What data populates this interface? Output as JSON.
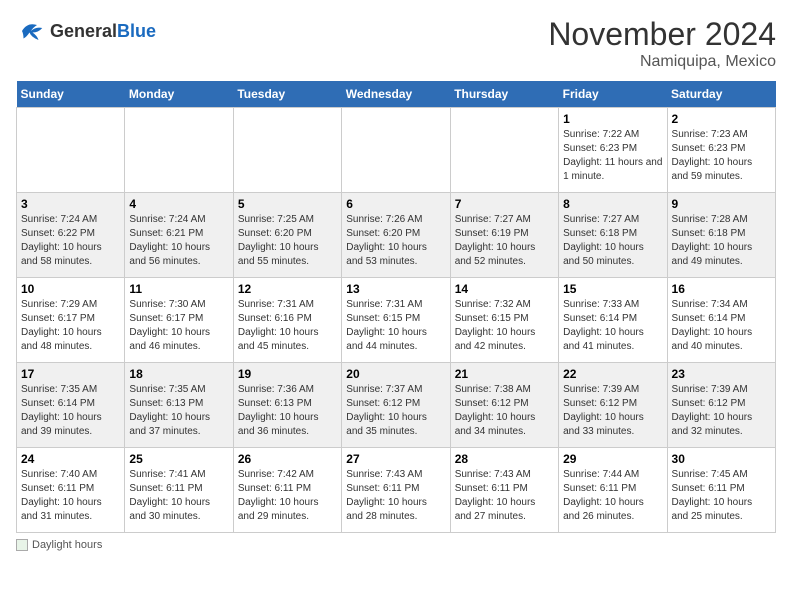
{
  "header": {
    "logo_general": "General",
    "logo_blue": "Blue",
    "month": "November 2024",
    "location": "Namiquipa, Mexico"
  },
  "weekdays": [
    "Sunday",
    "Monday",
    "Tuesday",
    "Wednesday",
    "Thursday",
    "Friday",
    "Saturday"
  ],
  "weeks": [
    [
      {
        "day": "",
        "sunrise": "",
        "sunset": "",
        "daylight": ""
      },
      {
        "day": "",
        "sunrise": "",
        "sunset": "",
        "daylight": ""
      },
      {
        "day": "",
        "sunrise": "",
        "sunset": "",
        "daylight": ""
      },
      {
        "day": "",
        "sunrise": "",
        "sunset": "",
        "daylight": ""
      },
      {
        "day": "",
        "sunrise": "",
        "sunset": "",
        "daylight": ""
      },
      {
        "day": "1",
        "sunrise": "Sunrise: 7:22 AM",
        "sunset": "Sunset: 6:23 PM",
        "daylight": "Daylight: 11 hours and 1 minute."
      },
      {
        "day": "2",
        "sunrise": "Sunrise: 7:23 AM",
        "sunset": "Sunset: 6:23 PM",
        "daylight": "Daylight: 10 hours and 59 minutes."
      }
    ],
    [
      {
        "day": "3",
        "sunrise": "Sunrise: 7:24 AM",
        "sunset": "Sunset: 6:22 PM",
        "daylight": "Daylight: 10 hours and 58 minutes."
      },
      {
        "day": "4",
        "sunrise": "Sunrise: 7:24 AM",
        "sunset": "Sunset: 6:21 PM",
        "daylight": "Daylight: 10 hours and 56 minutes."
      },
      {
        "day": "5",
        "sunrise": "Sunrise: 7:25 AM",
        "sunset": "Sunset: 6:20 PM",
        "daylight": "Daylight: 10 hours and 55 minutes."
      },
      {
        "day": "6",
        "sunrise": "Sunrise: 7:26 AM",
        "sunset": "Sunset: 6:20 PM",
        "daylight": "Daylight: 10 hours and 53 minutes."
      },
      {
        "day": "7",
        "sunrise": "Sunrise: 7:27 AM",
        "sunset": "Sunset: 6:19 PM",
        "daylight": "Daylight: 10 hours and 52 minutes."
      },
      {
        "day": "8",
        "sunrise": "Sunrise: 7:27 AM",
        "sunset": "Sunset: 6:18 PM",
        "daylight": "Daylight: 10 hours and 50 minutes."
      },
      {
        "day": "9",
        "sunrise": "Sunrise: 7:28 AM",
        "sunset": "Sunset: 6:18 PM",
        "daylight": "Daylight: 10 hours and 49 minutes."
      }
    ],
    [
      {
        "day": "10",
        "sunrise": "Sunrise: 7:29 AM",
        "sunset": "Sunset: 6:17 PM",
        "daylight": "Daylight: 10 hours and 48 minutes."
      },
      {
        "day": "11",
        "sunrise": "Sunrise: 7:30 AM",
        "sunset": "Sunset: 6:17 PM",
        "daylight": "Daylight: 10 hours and 46 minutes."
      },
      {
        "day": "12",
        "sunrise": "Sunrise: 7:31 AM",
        "sunset": "Sunset: 6:16 PM",
        "daylight": "Daylight: 10 hours and 45 minutes."
      },
      {
        "day": "13",
        "sunrise": "Sunrise: 7:31 AM",
        "sunset": "Sunset: 6:15 PM",
        "daylight": "Daylight: 10 hours and 44 minutes."
      },
      {
        "day": "14",
        "sunrise": "Sunrise: 7:32 AM",
        "sunset": "Sunset: 6:15 PM",
        "daylight": "Daylight: 10 hours and 42 minutes."
      },
      {
        "day": "15",
        "sunrise": "Sunrise: 7:33 AM",
        "sunset": "Sunset: 6:14 PM",
        "daylight": "Daylight: 10 hours and 41 minutes."
      },
      {
        "day": "16",
        "sunrise": "Sunrise: 7:34 AM",
        "sunset": "Sunset: 6:14 PM",
        "daylight": "Daylight: 10 hours and 40 minutes."
      }
    ],
    [
      {
        "day": "17",
        "sunrise": "Sunrise: 7:35 AM",
        "sunset": "Sunset: 6:14 PM",
        "daylight": "Daylight: 10 hours and 39 minutes."
      },
      {
        "day": "18",
        "sunrise": "Sunrise: 7:35 AM",
        "sunset": "Sunset: 6:13 PM",
        "daylight": "Daylight: 10 hours and 37 minutes."
      },
      {
        "day": "19",
        "sunrise": "Sunrise: 7:36 AM",
        "sunset": "Sunset: 6:13 PM",
        "daylight": "Daylight: 10 hours and 36 minutes."
      },
      {
        "day": "20",
        "sunrise": "Sunrise: 7:37 AM",
        "sunset": "Sunset: 6:12 PM",
        "daylight": "Daylight: 10 hours and 35 minutes."
      },
      {
        "day": "21",
        "sunrise": "Sunrise: 7:38 AM",
        "sunset": "Sunset: 6:12 PM",
        "daylight": "Daylight: 10 hours and 34 minutes."
      },
      {
        "day": "22",
        "sunrise": "Sunrise: 7:39 AM",
        "sunset": "Sunset: 6:12 PM",
        "daylight": "Daylight: 10 hours and 33 minutes."
      },
      {
        "day": "23",
        "sunrise": "Sunrise: 7:39 AM",
        "sunset": "Sunset: 6:12 PM",
        "daylight": "Daylight: 10 hours and 32 minutes."
      }
    ],
    [
      {
        "day": "24",
        "sunrise": "Sunrise: 7:40 AM",
        "sunset": "Sunset: 6:11 PM",
        "daylight": "Daylight: 10 hours and 31 minutes."
      },
      {
        "day": "25",
        "sunrise": "Sunrise: 7:41 AM",
        "sunset": "Sunset: 6:11 PM",
        "daylight": "Daylight: 10 hours and 30 minutes."
      },
      {
        "day": "26",
        "sunrise": "Sunrise: 7:42 AM",
        "sunset": "Sunset: 6:11 PM",
        "daylight": "Daylight: 10 hours and 29 minutes."
      },
      {
        "day": "27",
        "sunrise": "Sunrise: 7:43 AM",
        "sunset": "Sunset: 6:11 PM",
        "daylight": "Daylight: 10 hours and 28 minutes."
      },
      {
        "day": "28",
        "sunrise": "Sunrise: 7:43 AM",
        "sunset": "Sunset: 6:11 PM",
        "daylight": "Daylight: 10 hours and 27 minutes."
      },
      {
        "day": "29",
        "sunrise": "Sunrise: 7:44 AM",
        "sunset": "Sunset: 6:11 PM",
        "daylight": "Daylight: 10 hours and 26 minutes."
      },
      {
        "day": "30",
        "sunrise": "Sunrise: 7:45 AM",
        "sunset": "Sunset: 6:11 PM",
        "daylight": "Daylight: 10 hours and 25 minutes."
      }
    ]
  ],
  "footer": {
    "daylight_label": "Daylight hours"
  }
}
